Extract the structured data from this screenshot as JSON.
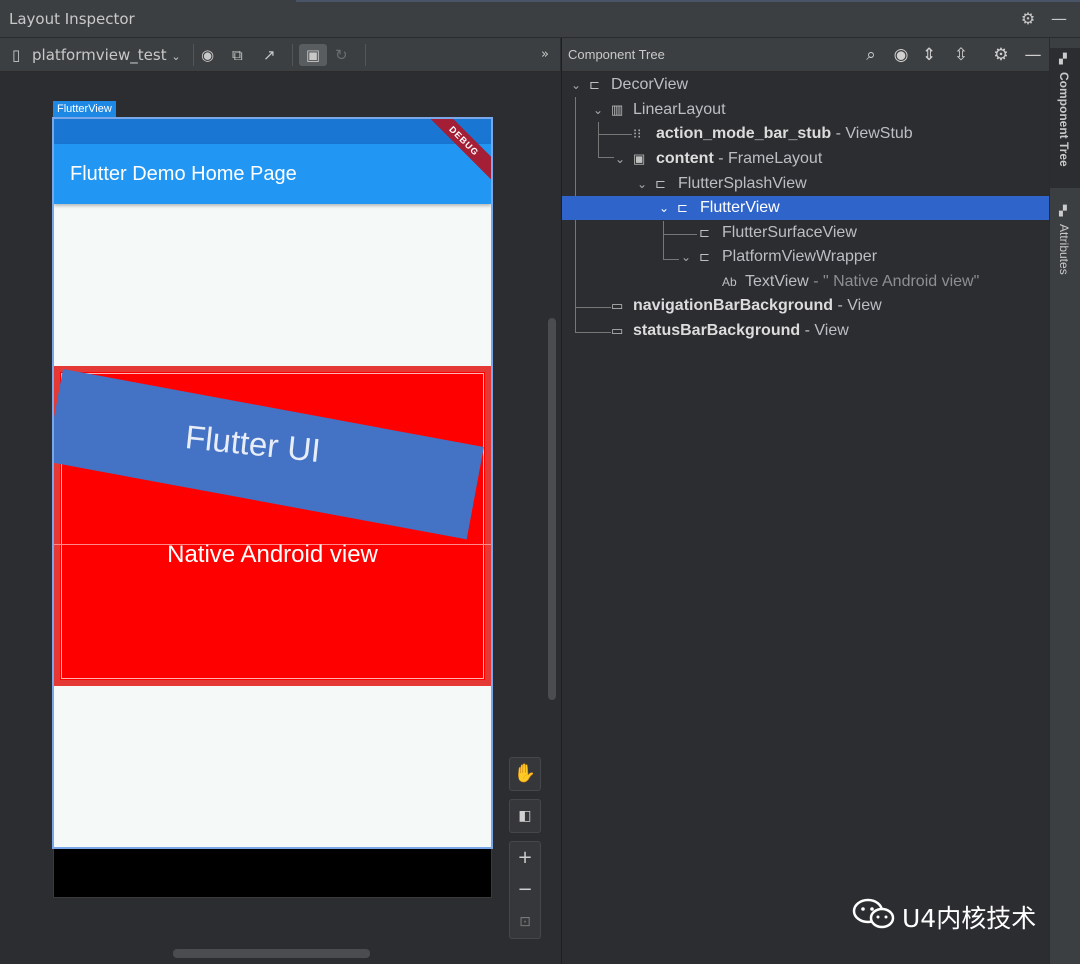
{
  "window": {
    "title": "Layout Inspector"
  },
  "toolbar": {
    "device_label": "platformview_test",
    "overflow": "»"
  },
  "device": {
    "selected_view_label": "FlutterView",
    "app_title": "Flutter Demo Home Page",
    "debug_banner": "DEBUG",
    "flutter_ui_text": "Flutter UI",
    "native_text": "Native Android view"
  },
  "component_tree": {
    "title": "Component Tree",
    "nodes": [
      {
        "name": "DecorView",
        "type": ""
      },
      {
        "name": "LinearLayout",
        "type": ""
      },
      {
        "name": "action_mode_bar_stub",
        "type": "- ViewStub"
      },
      {
        "name": "content",
        "type": "- FrameLayout"
      },
      {
        "name": "FlutterSplashView",
        "type": ""
      },
      {
        "name": "FlutterView",
        "type": ""
      },
      {
        "name": "FlutterSurfaceView",
        "type": ""
      },
      {
        "name": "PlatformViewWrapper",
        "type": ""
      },
      {
        "name": "TextView",
        "type": "- \"  Native Android view\""
      },
      {
        "name": "navigationBarBackground",
        "type": "- View"
      },
      {
        "name": "statusBarBackground",
        "type": "- View"
      }
    ],
    "textview_prefix": "Ab"
  },
  "side_tabs": {
    "component_tree": "Component Tree",
    "attributes": "Attributes"
  },
  "watermark": {
    "text": "U4内核技术"
  },
  "colors": {
    "selected": "#2f65ca",
    "app_bar": "#2196f3",
    "native_bg": "#ff0000",
    "flutter_ui": "#4472c4"
  }
}
